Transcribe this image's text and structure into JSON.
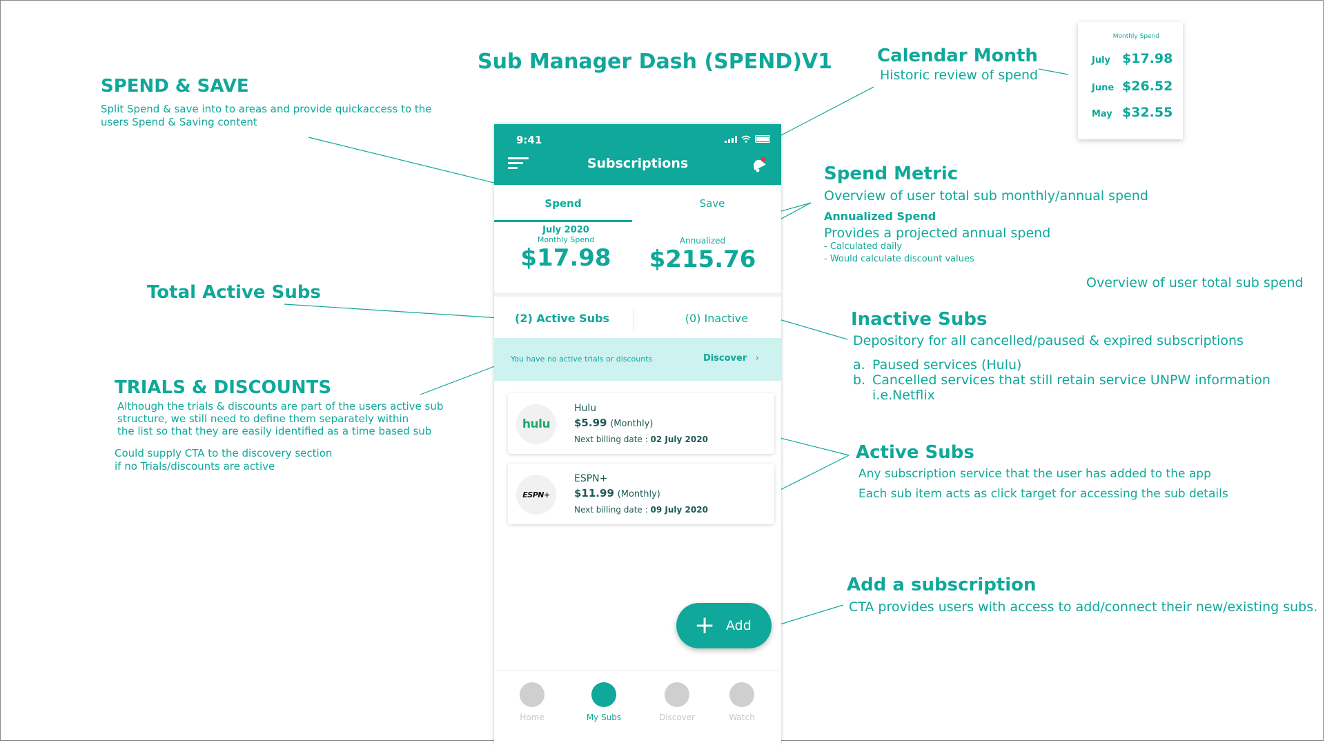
{
  "page_title": "Sub Manager Dash  (SPEND)V1",
  "annotations": {
    "spend_save": {
      "title": "SPEND & SAVE",
      "desc_1": "Split Spend & save into to areas and provide quickaccess to the",
      "desc_2": "users Spend & Saving content"
    },
    "calendar_month": {
      "title": "Calendar Month",
      "desc": "Historic review of spend"
    },
    "spend_metric": {
      "title": "Spend Metric",
      "desc": "Overview of user total sub monthly/annual spend",
      "annualized_title": "Annualized Spend",
      "annualized_desc": "Provides a projected annual spend",
      "bullet_1": "- Calculated daily",
      "bullet_2": "- Would calculate discount values"
    },
    "overview_note": "Overview of user total sub spend",
    "total_active_subs": {
      "title": "Total Active Subs"
    },
    "inactive_subs": {
      "title": "Inactive Subs",
      "desc": "Depository for all cancelled/paused & expired subscriptions",
      "item_a_marker": "a.",
      "item_a": "Paused services (Hulu)",
      "item_b_marker": "b.",
      "item_b": "Cancelled services that still retain  service UNPW information i.e.Netflix"
    },
    "trials_discounts": {
      "title": "TRIALS & DISCOUNTS",
      "desc_1": "Although the trials & discounts are part of the users active sub",
      "desc_2": "structure, we still need to define them separately within",
      "desc_3": "the list so that they are easily identified as a time based sub",
      "desc_4": "Could supply CTA to the discovery section",
      "desc_5": "if no Trials/discounts are active"
    },
    "active_subs": {
      "title": "Active Subs",
      "desc_1": "Any subscription service that the user has added to the app",
      "desc_2": "Each sub item acts as click target for accessing the sub details"
    },
    "add_subscription": {
      "title": "Add a subscription",
      "desc": "CTA provides users with access to add/connect their new/existing subs."
    }
  },
  "calendar_card": {
    "header": "Monthly Spend",
    "rows": [
      {
        "month": "July",
        "value": "$17.98"
      },
      {
        "month": "June",
        "value": "$26.52"
      },
      {
        "month": "May",
        "value": "$32.55"
      }
    ]
  },
  "phone": {
    "status_time": "9:41",
    "app_title": "Subscriptions",
    "tabs": {
      "spend": "Spend",
      "save": "Save"
    },
    "monthly": {
      "period": "July 2020",
      "label": "Monthly Spend",
      "value": "$17.98"
    },
    "annualized": {
      "label": "Annualized",
      "value": "$215.76"
    },
    "active_subs_label": "(2) Active Subs",
    "inactive_label": "(0) Inactive",
    "trial_message": "You have no active trials or discounts",
    "discover_label": "Discover",
    "discover_chevron": "›",
    "subs": [
      {
        "logo": "hulu",
        "name": "Hulu",
        "price": "$5.99",
        "period": "(Monthly)",
        "billing_label": "Next billing date :",
        "billing_date": "02 July 2020"
      },
      {
        "logo": "ESPN+",
        "name": "ESPN+",
        "price": "$11.99",
        "period": "(Monthly)",
        "billing_label": "Next billing date :",
        "billing_date": "09 July 2020"
      }
    ],
    "add_label": "Add",
    "add_icon": "+",
    "nav": [
      {
        "label": "Home"
      },
      {
        "label": "My Subs"
      },
      {
        "label": "Discover"
      },
      {
        "label": "Watch"
      }
    ]
  }
}
